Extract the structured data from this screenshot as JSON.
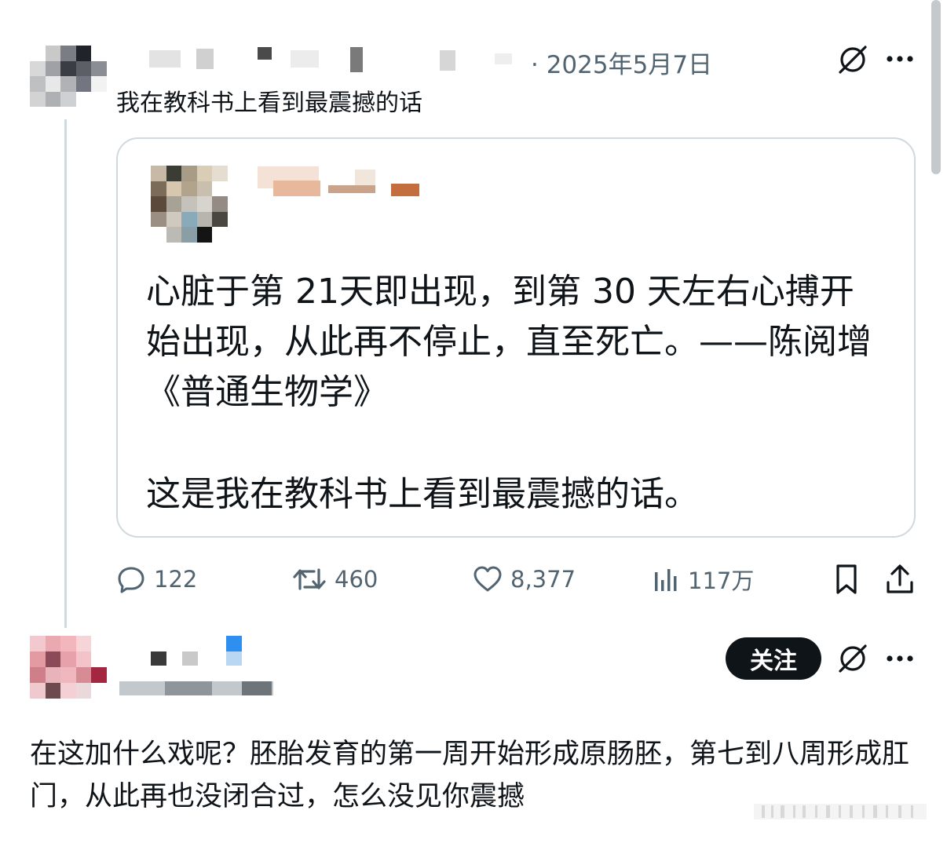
{
  "post": {
    "date": "· 2025年5月7日",
    "title": "我在教科书上看到最震撼的话",
    "more_icon": "more-horizontal-icon",
    "grok_icon": "grok-icon"
  },
  "quote": {
    "text_line1": "心脏于第 21天即出现，到第 30 天左右心搏开始出现，从此再不停止，直至死亡。——陈阅增《普通生物学》",
    "text_line2": "这是我在教科书上看到最震撼的话。"
  },
  "actions": {
    "replies": "122",
    "reposts": "460",
    "likes": "8,377",
    "views": "117万"
  },
  "reply": {
    "follow_label": "关注",
    "text": "在这加什么戏呢？胚胎发育的第一周开始形成原肠胚，第七到八周形成肛门，从此再也没闭合过，怎么没见你震撼"
  },
  "colors": {
    "text_primary": "#0f1419",
    "text_secondary": "#536471",
    "border": "#cfd9de",
    "follow_bg": "#0f1419"
  }
}
